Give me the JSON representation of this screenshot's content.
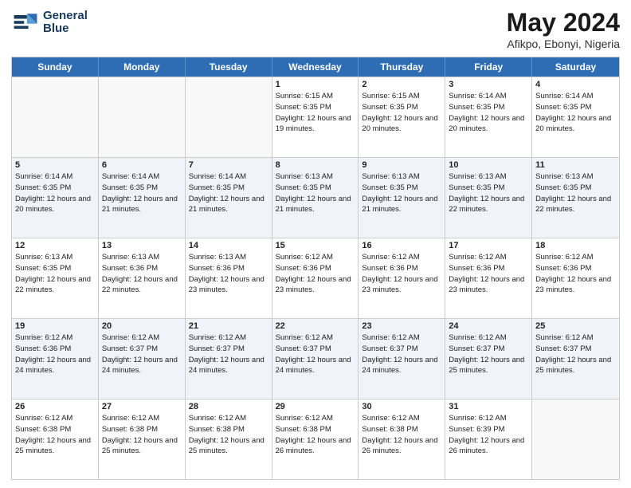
{
  "header": {
    "logo_line1": "General",
    "logo_line2": "Blue",
    "title": "May 2024",
    "location": "Afikpo, Ebonyi, Nigeria"
  },
  "days_of_week": [
    "Sunday",
    "Monday",
    "Tuesday",
    "Wednesday",
    "Thursday",
    "Friday",
    "Saturday"
  ],
  "weeks": [
    [
      {
        "day": "",
        "empty": true
      },
      {
        "day": "",
        "empty": true
      },
      {
        "day": "",
        "empty": true
      },
      {
        "day": "1",
        "sunrise": "6:15 AM",
        "sunset": "6:35 PM",
        "daylight": "12 hours and 19 minutes."
      },
      {
        "day": "2",
        "sunrise": "6:15 AM",
        "sunset": "6:35 PM",
        "daylight": "12 hours and 20 minutes."
      },
      {
        "day": "3",
        "sunrise": "6:14 AM",
        "sunset": "6:35 PM",
        "daylight": "12 hours and 20 minutes."
      },
      {
        "day": "4",
        "sunrise": "6:14 AM",
        "sunset": "6:35 PM",
        "daylight": "12 hours and 20 minutes."
      }
    ],
    [
      {
        "day": "5",
        "sunrise": "6:14 AM",
        "sunset": "6:35 PM",
        "daylight": "12 hours and 20 minutes."
      },
      {
        "day": "6",
        "sunrise": "6:14 AM",
        "sunset": "6:35 PM",
        "daylight": "12 hours and 21 minutes."
      },
      {
        "day": "7",
        "sunrise": "6:14 AM",
        "sunset": "6:35 PM",
        "daylight": "12 hours and 21 minutes."
      },
      {
        "day": "8",
        "sunrise": "6:13 AM",
        "sunset": "6:35 PM",
        "daylight": "12 hours and 21 minutes."
      },
      {
        "day": "9",
        "sunrise": "6:13 AM",
        "sunset": "6:35 PM",
        "daylight": "12 hours and 21 minutes."
      },
      {
        "day": "10",
        "sunrise": "6:13 AM",
        "sunset": "6:35 PM",
        "daylight": "12 hours and 22 minutes."
      },
      {
        "day": "11",
        "sunrise": "6:13 AM",
        "sunset": "6:35 PM",
        "daylight": "12 hours and 22 minutes."
      }
    ],
    [
      {
        "day": "12",
        "sunrise": "6:13 AM",
        "sunset": "6:35 PM",
        "daylight": "12 hours and 22 minutes."
      },
      {
        "day": "13",
        "sunrise": "6:13 AM",
        "sunset": "6:36 PM",
        "daylight": "12 hours and 22 minutes."
      },
      {
        "day": "14",
        "sunrise": "6:13 AM",
        "sunset": "6:36 PM",
        "daylight": "12 hours and 23 minutes."
      },
      {
        "day": "15",
        "sunrise": "6:12 AM",
        "sunset": "6:36 PM",
        "daylight": "12 hours and 23 minutes."
      },
      {
        "day": "16",
        "sunrise": "6:12 AM",
        "sunset": "6:36 PM",
        "daylight": "12 hours and 23 minutes."
      },
      {
        "day": "17",
        "sunrise": "6:12 AM",
        "sunset": "6:36 PM",
        "daylight": "12 hours and 23 minutes."
      },
      {
        "day": "18",
        "sunrise": "6:12 AM",
        "sunset": "6:36 PM",
        "daylight": "12 hours and 23 minutes."
      }
    ],
    [
      {
        "day": "19",
        "sunrise": "6:12 AM",
        "sunset": "6:36 PM",
        "daylight": "12 hours and 24 minutes."
      },
      {
        "day": "20",
        "sunrise": "6:12 AM",
        "sunset": "6:37 PM",
        "daylight": "12 hours and 24 minutes."
      },
      {
        "day": "21",
        "sunrise": "6:12 AM",
        "sunset": "6:37 PM",
        "daylight": "12 hours and 24 minutes."
      },
      {
        "day": "22",
        "sunrise": "6:12 AM",
        "sunset": "6:37 PM",
        "daylight": "12 hours and 24 minutes."
      },
      {
        "day": "23",
        "sunrise": "6:12 AM",
        "sunset": "6:37 PM",
        "daylight": "12 hours and 24 minutes."
      },
      {
        "day": "24",
        "sunrise": "6:12 AM",
        "sunset": "6:37 PM",
        "daylight": "12 hours and 25 minutes."
      },
      {
        "day": "25",
        "sunrise": "6:12 AM",
        "sunset": "6:37 PM",
        "daylight": "12 hours and 25 minutes."
      }
    ],
    [
      {
        "day": "26",
        "sunrise": "6:12 AM",
        "sunset": "6:38 PM",
        "daylight": "12 hours and 25 minutes."
      },
      {
        "day": "27",
        "sunrise": "6:12 AM",
        "sunset": "6:38 PM",
        "daylight": "12 hours and 25 minutes."
      },
      {
        "day": "28",
        "sunrise": "6:12 AM",
        "sunset": "6:38 PM",
        "daylight": "12 hours and 25 minutes."
      },
      {
        "day": "29",
        "sunrise": "6:12 AM",
        "sunset": "6:38 PM",
        "daylight": "12 hours and 26 minutes."
      },
      {
        "day": "30",
        "sunrise": "6:12 AM",
        "sunset": "6:38 PM",
        "daylight": "12 hours and 26 minutes."
      },
      {
        "day": "31",
        "sunrise": "6:12 AM",
        "sunset": "6:39 PM",
        "daylight": "12 hours and 26 minutes."
      },
      {
        "day": "",
        "empty": true
      }
    ]
  ]
}
